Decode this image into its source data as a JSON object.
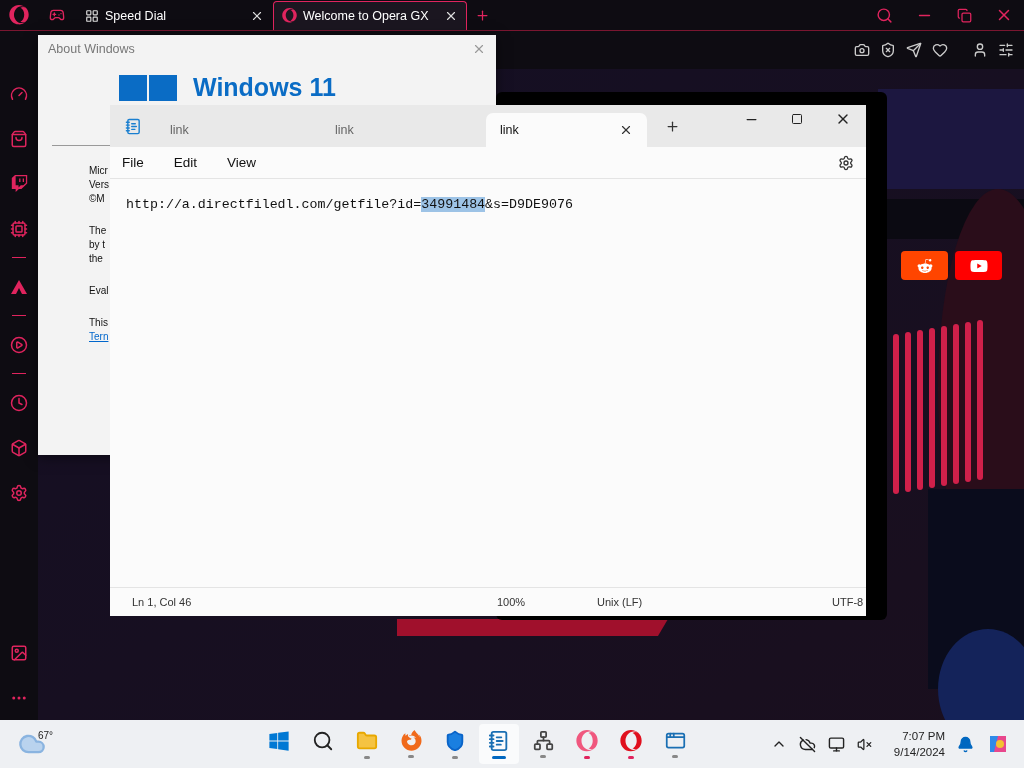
{
  "browser": {
    "tabs": [
      {
        "label": "Speed Dial",
        "selected": false
      },
      {
        "label": "Welcome to Opera GX",
        "selected": true
      }
    ]
  },
  "about_window": {
    "title": "About Windows",
    "logo_text": "Windows 11",
    "paragraphs": [
      {
        "lines": [
          {
            "kind": "text",
            "text": "Micr"
          },
          {
            "kind": "text",
            "text": "Vers"
          },
          {
            "kind": "text",
            "text": "©M"
          }
        ]
      },
      {
        "lines": [
          {
            "kind": "text",
            "text": "The"
          },
          {
            "kind": "text",
            "text": "by t"
          },
          {
            "kind": "text",
            "text": "the"
          }
        ]
      },
      {
        "lines": [
          {
            "kind": "text",
            "text": "Eval"
          }
        ]
      },
      {
        "lines": [
          {
            "kind": "text",
            "text": "This"
          },
          {
            "kind": "link",
            "text": "Tern"
          }
        ]
      }
    ]
  },
  "notepad": {
    "tabs": [
      {
        "label": "link",
        "selected": false
      },
      {
        "label": "link",
        "selected": false
      },
      {
        "label": "link",
        "selected": true
      }
    ],
    "menu": [
      "File",
      "Edit",
      "View"
    ],
    "content": {
      "before": "http://a.directfiledl.com/getfile?id=",
      "selection": "34991484",
      "after": "&s=D9DE9076"
    },
    "status": [
      "Ln 1, Col 46",
      "100%",
      "Unix (LF)",
      "UTF-8"
    ]
  },
  "taskbar": {
    "weather": "67°",
    "apps": [
      {
        "kind": "start",
        "running": false,
        "active": false
      },
      {
        "kind": "search",
        "running": false,
        "active": false
      },
      {
        "kind": "folder",
        "running": true,
        "active": false
      },
      {
        "kind": "firefox",
        "running": true,
        "active": false
      },
      {
        "kind": "shield",
        "running": true,
        "active": false
      },
      {
        "kind": "notepad",
        "running": true,
        "active": true
      },
      {
        "kind": "network",
        "running": true,
        "active": false
      },
      {
        "kind": "operagx",
        "running": true,
        "active": false
      },
      {
        "kind": "opera",
        "running": true,
        "active": false
      },
      {
        "kind": "window",
        "running": true,
        "active": false
      }
    ],
    "time": "7:07 PM",
    "date": "9/14/2024"
  }
}
